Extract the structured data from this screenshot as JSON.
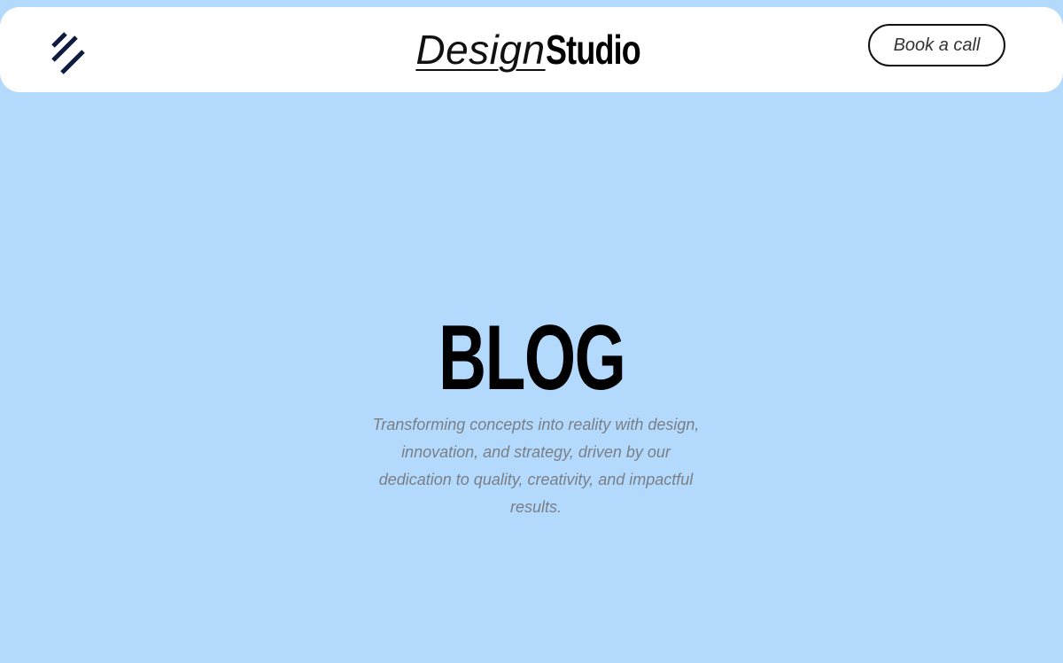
{
  "header": {
    "logo": {
      "part1": "Design",
      "part2": "Studio"
    },
    "menu_icon": "diagonal-stripes-menu-icon",
    "book_button_label": "Book a call"
  },
  "hero": {
    "title": "BLOG",
    "description": "Transforming concepts into reality with design, innovation, and strategy, driven by our dedication to quality, creativity, and impactful results."
  },
  "colors": {
    "background": "#b3d9fd",
    "header_bg": "#ffffff",
    "icon": "#0d1b3e",
    "text_primary": "#000000",
    "text_muted": "#7a7f86"
  }
}
